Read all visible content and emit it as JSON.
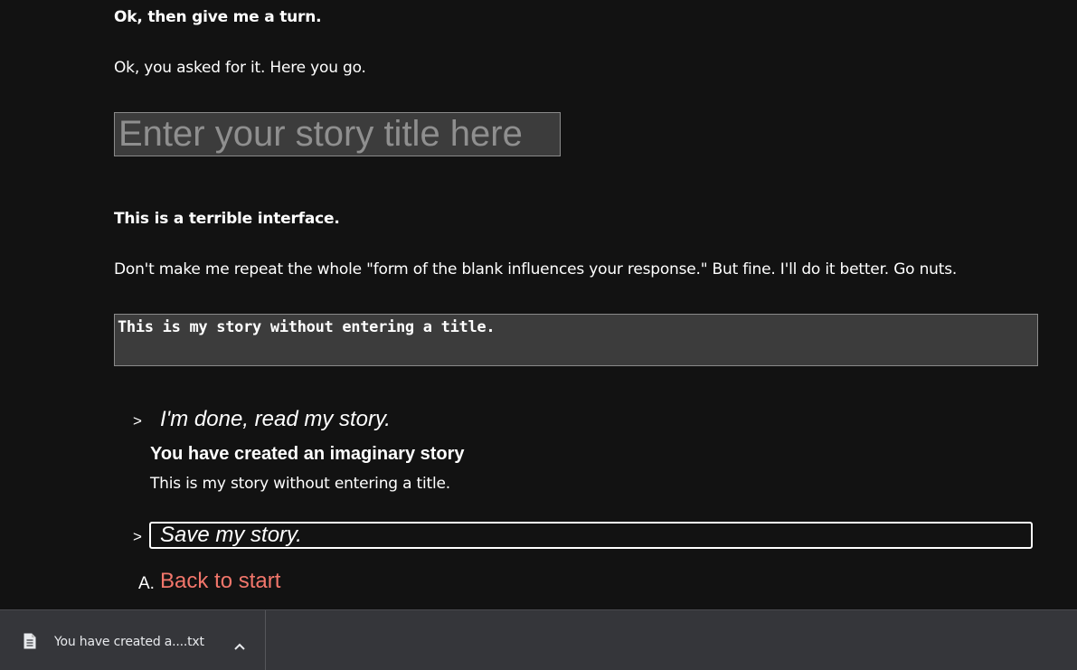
{
  "conversation": {
    "user_line_1": "Ok, then give me a turn.",
    "reply_1": "Ok, you asked for it. Here you go.",
    "title_input": {
      "placeholder": "Enter your story title here",
      "value": ""
    },
    "user_line_2": "This is a terrible interface.",
    "reply_2": "Don't make me repeat the whole \"form of the blank influences your response.\" But fine. I'll do it better. Go nuts.",
    "story_input": {
      "value": "This is my story without entering a title."
    }
  },
  "choices": {
    "read_marker": ">",
    "read_label": "I'm done, read my story.",
    "save_marker": ">",
    "save_label": "Save my story.",
    "back_marker": "A.",
    "back_label": "Back to start",
    "back_color": "#f2766b"
  },
  "story_output": {
    "heading": "You have created an imaginary story",
    "body": "This is my story without entering a title."
  },
  "download_bar": {
    "file_icon": "file-document-icon",
    "file_name": "You have created a....txt",
    "expand_icon": "chevron-up-icon"
  }
}
